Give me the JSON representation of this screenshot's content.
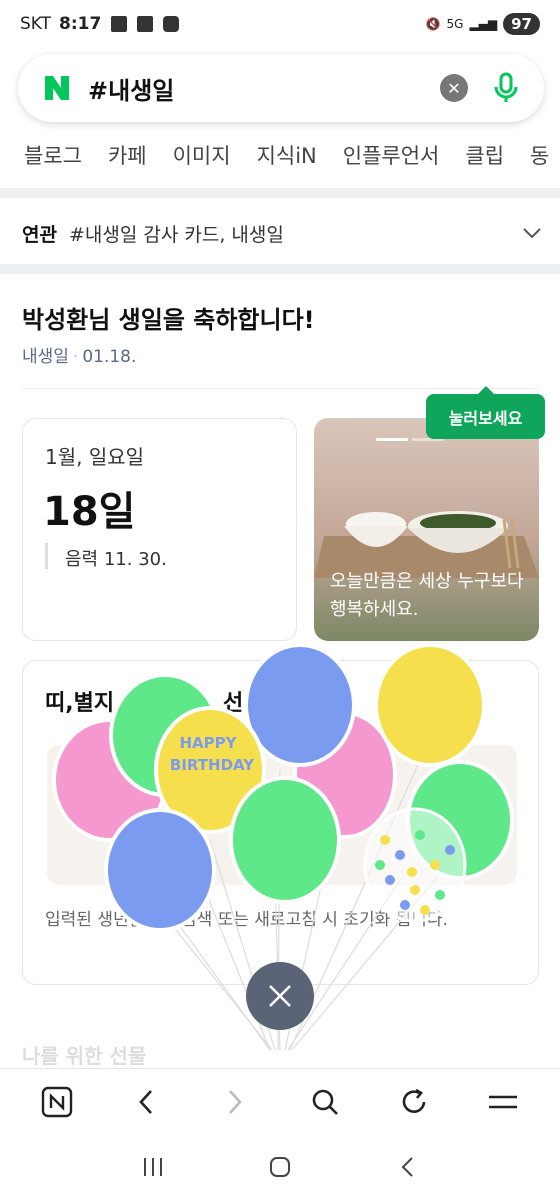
{
  "status_bar": {
    "carrier": "SKT",
    "time": "8:17",
    "battery": "97"
  },
  "search": {
    "logo": "N",
    "query": "#내생일",
    "clear_icon": "close-circle-icon",
    "mic_icon": "mic-icon"
  },
  "tabs": [
    "블로그",
    "카페",
    "이미지",
    "지식iN",
    "인플루언서",
    "클립",
    "동"
  ],
  "related": {
    "label": "연관",
    "keywords": "#내생일 감사 카드, 내생일"
  },
  "birthday": {
    "title": "박성환님 생일을 축하합니다!",
    "source": "내생일",
    "date": "01.18."
  },
  "date_card": {
    "weekday": "1월, 일요일",
    "day": "18일",
    "lunar": "음력 11. 30."
  },
  "photo_card": {
    "message": "오늘만큼은 세상 누구보다 행복하세요."
  },
  "tooltip": "눌러보세요",
  "zodiac": {
    "title_start": "띠,별지",
    "title_end": "선",
    "note": "입력된 생년월일로 검색 또는 새로고침 시 초기화 됩니다."
  },
  "balloon_text": [
    "HAPPY",
    "BIRTHDAY"
  ],
  "next_section": "나를 위한 선물",
  "colors": {
    "naver_green": "#03c75a",
    "tooltip_green": "#0fa55a",
    "close_fab": "#5b6477",
    "balloon_green": "#5ee88a",
    "balloon_blue": "#7b9bf0",
    "balloon_pink": "#f498cf",
    "balloon_yellow": "#f6df4c"
  }
}
